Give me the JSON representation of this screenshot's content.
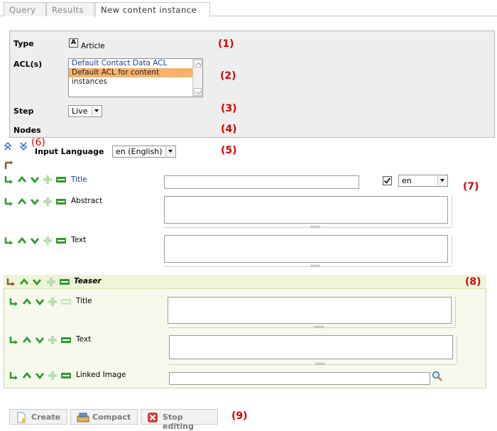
{
  "tabs": [
    {
      "label": "Query"
    },
    {
      "label": "Results"
    },
    {
      "label": "New content instance"
    }
  ],
  "properties": {
    "type_label": "Type",
    "type_value": "Article",
    "type_icon_letter": "A",
    "acl_label": "ACL(s)",
    "acl_options": [
      "Default Contact Data ACL",
      "Default ACL for content instances"
    ],
    "step_label": "Step",
    "step_value": "Live",
    "nodes_label": "Nodes"
  },
  "language": {
    "label": "Input Language",
    "value": "en (English)"
  },
  "fields": {
    "title_label": "Title",
    "title_lang": "en",
    "abstract_label": "Abstract",
    "text_label": "Text"
  },
  "teaser": {
    "heading": "Teaser",
    "title_label": "Title",
    "text_label": "Text",
    "image_label": "Linked Image"
  },
  "buttons": {
    "create": "Create",
    "compact": "Compact",
    "stop": "Stop editing"
  },
  "markers": [
    "(1)",
    "(2)",
    "(3)",
    "(4)",
    "(5)",
    "(6)",
    "(7)",
    "(8)",
    "(9)"
  ],
  "colors": {
    "marker": "#dd0000",
    "acl_selected": "#f6b26b",
    "icon_green": "#2e9a2e"
  }
}
